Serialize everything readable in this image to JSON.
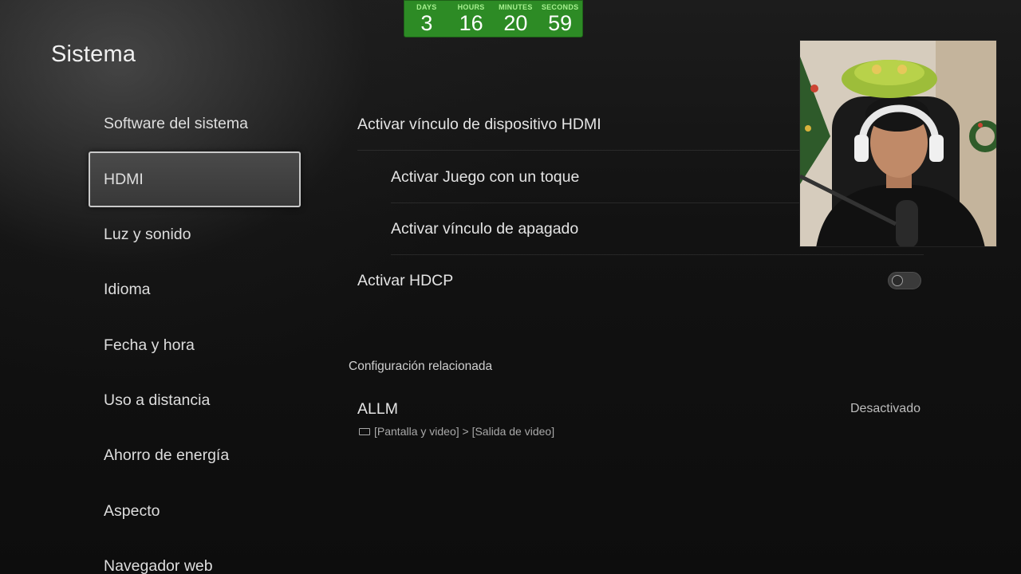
{
  "timer": {
    "days_label": "DAYS",
    "days": "3",
    "hours_label": "HOURS",
    "hours": "16",
    "minutes_label": "MINUTES",
    "minutes": "20",
    "seconds_label": "SECONDS",
    "seconds": "59",
    "color": "#2d8b25"
  },
  "page": {
    "title": "Sistema"
  },
  "sidebar": {
    "items": [
      {
        "label": "Software del sistema"
      },
      {
        "label": "HDMI",
        "selected": true
      },
      {
        "label": "Luz y sonido"
      },
      {
        "label": "Idioma"
      },
      {
        "label": "Fecha y hora"
      },
      {
        "label": "Uso a distancia"
      },
      {
        "label": "Ahorro de energía"
      },
      {
        "label": "Aspecto"
      },
      {
        "label": "Navegador web"
      }
    ]
  },
  "settings": {
    "hdmi_link": "Activar vínculo de dispositivo HDMI",
    "one_touch_play": "Activar Juego con un toque",
    "power_off_link": "Activar vínculo de apagado",
    "hdcp": "Activar HDCP",
    "hdcp_enabled": false
  },
  "related": {
    "heading": "Configuración relacionada",
    "allm_label": "ALLM",
    "allm_value": "Desactivado",
    "allm_path": "[Pantalla y video] > [Salida de video]"
  },
  "icons": {
    "screen": "screen-icon",
    "toggle": "toggle-off"
  }
}
